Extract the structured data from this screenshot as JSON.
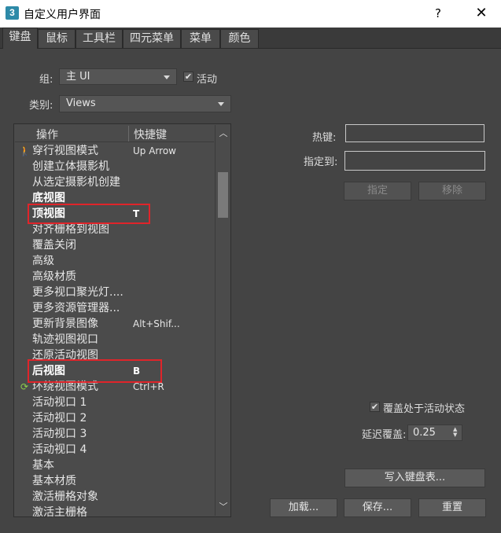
{
  "window": {
    "title": "自定义用户界面",
    "app_icon_glyph": "3",
    "help_glyph": "?",
    "close_glyph": "✕"
  },
  "tabs": [
    {
      "label": "键盘",
      "active": true
    },
    {
      "label": "鼠标",
      "active": false
    },
    {
      "label": "工具栏",
      "active": false
    },
    {
      "label": "四元菜单",
      "active": false
    },
    {
      "label": "菜单",
      "active": false
    },
    {
      "label": "颜色",
      "active": false
    }
  ],
  "group": {
    "label": "组:",
    "value": "主 UI"
  },
  "active_checkbox": {
    "label": "活动",
    "checked": true,
    "glyph": "✔"
  },
  "category": {
    "label": "类别:",
    "value": "Views"
  },
  "list": {
    "col_action": "操作",
    "col_shortcut": "快捷键",
    "rows": [
      {
        "action": "穿行视图模式",
        "key": "Up Arrow",
        "icon": "walk-icon",
        "glyph": "🚶",
        "bold": false
      },
      {
        "action": "创建立体摄影机",
        "key": "",
        "bold": false
      },
      {
        "action": "从选定摄影机创建",
        "key": "",
        "bold": false
      },
      {
        "action": "底视图",
        "key": "",
        "bold": true
      },
      {
        "action": "顶视图",
        "key": "T",
        "bold": true
      },
      {
        "action": "对齐栅格到视图",
        "key": "",
        "bold": false
      },
      {
        "action": "覆盖关闭",
        "key": "",
        "bold": false
      },
      {
        "action": "高级",
        "key": "",
        "bold": false
      },
      {
        "action": "高级材质",
        "key": "",
        "bold": false
      },
      {
        "action": "更多视口聚光灯....",
        "key": "",
        "bold": false
      },
      {
        "action": "更多资源管理器...",
        "key": "",
        "bold": false
      },
      {
        "action": "更新背景图像",
        "key": "Alt+Shif...",
        "bold": false
      },
      {
        "action": "轨迹视图视口",
        "key": "",
        "bold": false
      },
      {
        "action": "还原活动视图",
        "key": "",
        "bold": false
      },
      {
        "action": "后视图",
        "key": "B",
        "bold": true
      },
      {
        "action": "环绕视图模式",
        "key": "Ctrl+R",
        "icon": "orbit-icon",
        "glyph": "⟳",
        "bold": false
      },
      {
        "action": "活动视口 1",
        "key": "",
        "bold": false
      },
      {
        "action": "活动视口 2",
        "key": "",
        "bold": false
      },
      {
        "action": "活动视口 3",
        "key": "",
        "bold": false
      },
      {
        "action": "活动视口 4",
        "key": "",
        "bold": false
      },
      {
        "action": "基本",
        "key": "",
        "bold": false
      },
      {
        "action": "基本材质",
        "key": "",
        "bold": false
      },
      {
        "action": "激活栅格对象",
        "key": "",
        "bold": false
      },
      {
        "action": "激活主栅格",
        "key": "",
        "bold": false
      }
    ]
  },
  "hotkey": {
    "label": "热键:",
    "value": ""
  },
  "assign_to": {
    "label": "指定到:",
    "value": ""
  },
  "buttons": {
    "assign": "指定",
    "remove": "移除",
    "write_keyboard": "写入键盘表...",
    "load": "加载...",
    "save": "保存...",
    "reset": "重置"
  },
  "override_checkbox": {
    "label": "覆盖处于活动状态",
    "checked": true,
    "glyph": "✔"
  },
  "delay_override": {
    "label": "延迟覆盖:",
    "value": "0.25"
  },
  "colors": {
    "highlight": "#e0242a",
    "background": "#444444"
  }
}
